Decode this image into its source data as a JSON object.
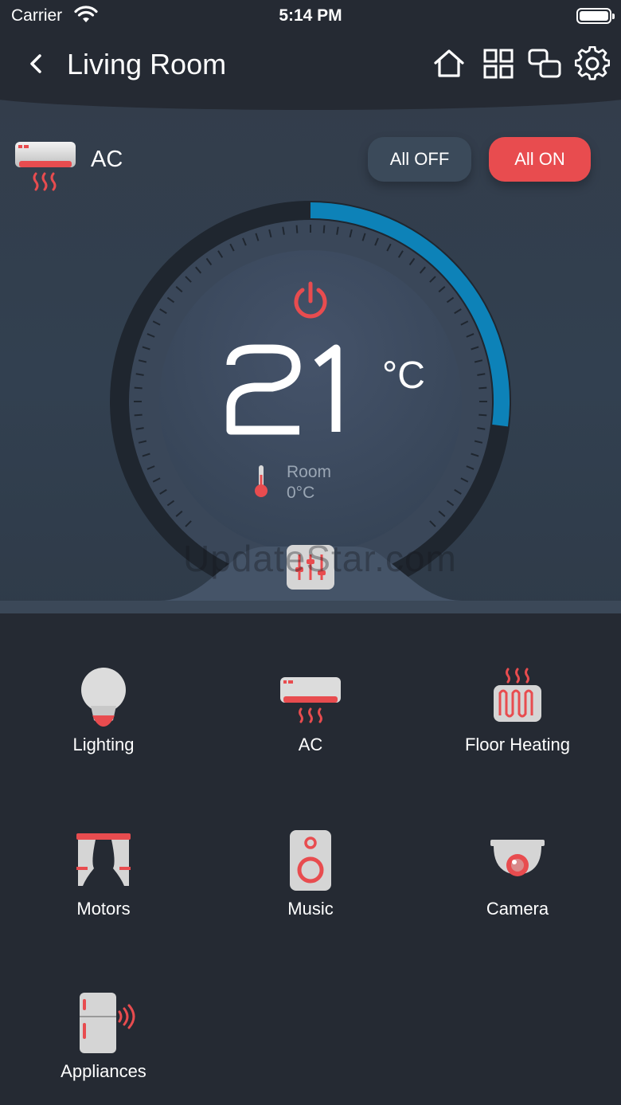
{
  "status": {
    "carrier": "Carrier",
    "time": "5:14 PM"
  },
  "nav": {
    "title": "Living Room"
  },
  "ac": {
    "label": "AC",
    "all_off_label": "All OFF",
    "all_on_label": "All ON",
    "set_temperature": "21",
    "unit": "°C",
    "room_label": "Room",
    "room_temperature": "0°C",
    "dial_fill_fraction": 0.2
  },
  "colors": {
    "accent_red": "#e84c4f",
    "dial_blue": "#0d82b8",
    "panel": "#323e4d",
    "background": "#252a33"
  },
  "devices": [
    {
      "label": "Lighting",
      "icon": "lightbulb-icon"
    },
    {
      "label": "AC",
      "icon": "air-conditioner-icon"
    },
    {
      "label": "Floor Heating",
      "icon": "floor-heating-icon"
    },
    {
      "label": "Motors",
      "icon": "curtain-motor-icon"
    },
    {
      "label": "Music",
      "icon": "speaker-icon"
    },
    {
      "label": "Camera",
      "icon": "camera-icon"
    },
    {
      "label": "Appliances",
      "icon": "fridge-icon"
    }
  ],
  "watermark": "UpdateStar.com"
}
